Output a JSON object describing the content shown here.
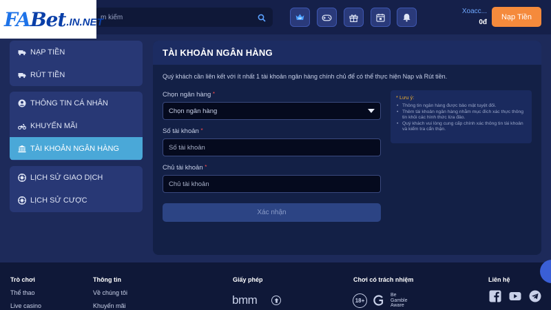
{
  "brand": {
    "logo_fa": "FA",
    "logo_bet": "Bet",
    "logo_domain": ".IN.NET"
  },
  "header": {
    "search_placeholder": "m kiếm",
    "icons": [
      "vip-icon",
      "gamepad-icon",
      "gift-icon",
      "calendar-icon",
      "bell-icon"
    ],
    "icon_vip_text": "VIP",
    "username": "Xoacc...",
    "balance": "0đ",
    "deposit_label": "Nạp Tiền"
  },
  "sidebar": {
    "groups": [
      {
        "items": [
          {
            "label": "NẠP TIỀN",
            "icon": "truck-icon"
          },
          {
            "label": "RÚT TIỀN",
            "icon": "truck-icon"
          }
        ]
      },
      {
        "items": [
          {
            "label": "THÔNG TIN CÁ NHÂN",
            "icon": "user-circle-icon"
          },
          {
            "label": "KHUYẾN MÃI",
            "icon": "motorbike-icon"
          },
          {
            "label": "TÀI KHOẢN NGÂN HÀNG",
            "icon": "bank-icon",
            "active": true
          }
        ]
      },
      {
        "items": [
          {
            "label": "LỊCH SỬ GIAO DỊCH",
            "icon": "chip-icon"
          },
          {
            "label": "LỊCH SỬ CƯỢC",
            "icon": "chip-icon"
          }
        ]
      }
    ]
  },
  "main": {
    "title": "TÀI KHOẢN NGÂN HÀNG",
    "intro": "Quý khách cần liên kết với ít nhất 1 tài khoản ngân hàng chính chủ để có thể thực hiện Nạp và Rút tiền.",
    "fields": {
      "bank": {
        "label": "Chọn ngân hàng",
        "required": "*",
        "value": "Chọn ngân hàng"
      },
      "account_number": {
        "label": "Số tài khoản",
        "required": "*",
        "placeholder": "Số tài khoản"
      },
      "account_holder": {
        "label": "Chủ tài khoản",
        "required": "*",
        "placeholder": "Chủ tài khoản"
      }
    },
    "submit_label": "Xác nhận",
    "note": {
      "title": "* Lưu ý:",
      "items": [
        "Thông tin ngân hàng được bảo mật tuyệt đối.",
        "Thêm tài khoản ngân hàng nhằm mục đích xác thực thông tin khỏi các hình thức lừa đảo.",
        "Quý khách vui lòng cung cấp chính xác thông tin tài khoản và kiểm tra cẩn thận."
      ]
    }
  },
  "footer": {
    "games": {
      "title": "Trò chơi",
      "links": [
        "Thể thao",
        "Live casino"
      ]
    },
    "info": {
      "title": "Thông tin",
      "links": [
        "Về chúng tôi",
        "Khuyến mãi"
      ]
    },
    "license": {
      "title": "Giấy phép",
      "bmm": "bmm"
    },
    "responsible": {
      "title": "Chơi có trách nhiệm",
      "age": "18+",
      "gamcare": "GamCare",
      "begamble": [
        "Be",
        "Gamble",
        "Aware"
      ]
    },
    "contact": {
      "title": "Liên hệ",
      "icons": [
        "facebook-icon",
        "youtube-icon",
        "telegram-icon"
      ]
    }
  },
  "colors": {
    "background": "#1d2a5a",
    "panel": "#132046",
    "sidebar_active": "#4aa8d8",
    "deposit_button": "#f58a3c",
    "required_star": "#ff4b4b",
    "note_title": "#f0b030"
  }
}
